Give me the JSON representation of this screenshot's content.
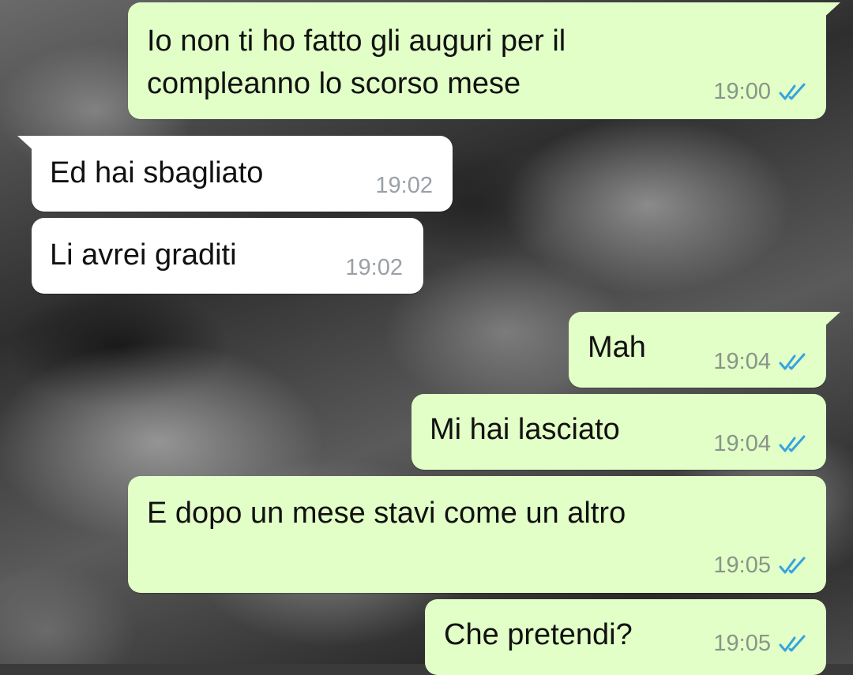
{
  "chat": {
    "messages": [
      {
        "direction": "outgoing",
        "text": "Io non ti ho fatto gli auguri per il\ncompleanno lo scorso mese",
        "time": "19:00",
        "status": "read"
      },
      {
        "direction": "incoming",
        "text": "Ed hai sbagliato",
        "time": "19:02"
      },
      {
        "direction": "incoming",
        "text": "Li avrei graditi",
        "time": "19:02"
      },
      {
        "direction": "outgoing",
        "text": "Mah",
        "time": "19:04",
        "status": "read"
      },
      {
        "direction": "outgoing",
        "text": "Mi hai lasciato",
        "time": "19:04",
        "status": "read"
      },
      {
        "direction": "outgoing",
        "text": "E dopo un mese stavi come un altro",
        "time": "19:05",
        "status": "read"
      },
      {
        "direction": "outgoing",
        "text": "Che pretendi?",
        "time": "19:05",
        "status": "read"
      }
    ]
  },
  "icons": {
    "read_receipt": "double-check-icon"
  },
  "colors": {
    "outgoing_bubble": "#e2ffc7",
    "incoming_bubble": "#ffffff",
    "read_tick": "#34a3e0",
    "timestamp": "#8a9488"
  }
}
